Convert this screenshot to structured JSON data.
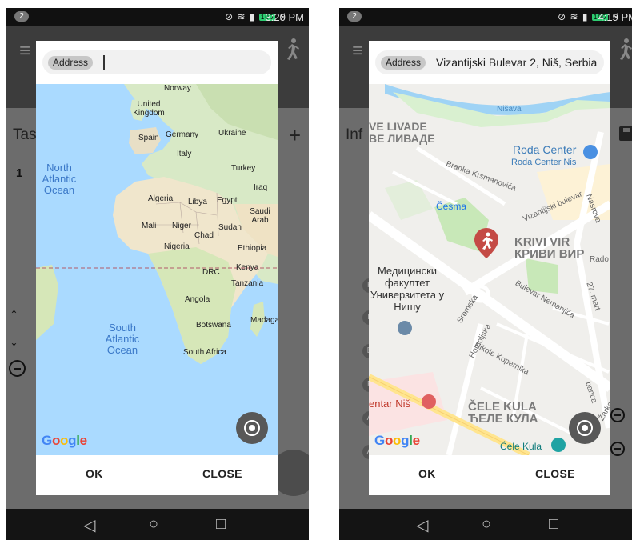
{
  "screens": [
    {
      "status": {
        "notifications": "2",
        "battery": "100",
        "time": "3:20 PM"
      },
      "background": {
        "title": "Tas",
        "action": "+",
        "row_number": "1"
      },
      "address_label": "Address",
      "address_value": "",
      "map_labels": {
        "norway": "Norway",
        "uk": "United Kingdom",
        "germany": "Germany",
        "ukraine": "Ukraine",
        "spain": "Spain",
        "italy": "Italy",
        "turkey": "Turkey",
        "iraq": "Iraq",
        "north_atlantic": "North Atlantic Ocean",
        "algeria": "Algeria",
        "libya": "Libya",
        "egypt": "Egypt",
        "saudi": "Saudi Arab",
        "mali": "Mali",
        "niger": "Niger",
        "chad": "Chad",
        "sudan": "Sudan",
        "nigeria": "Nigeria",
        "ethiopia": "Ethiopia",
        "drc": "DRC",
        "kenya": "Kenya",
        "tanzania": "Tanzania",
        "angola": "Angola",
        "south_atlantic": "South Atlantic Ocean",
        "botswana": "Botswana",
        "madagascar": "Madaga",
        "south_africa": "South Africa"
      },
      "logo": "Google",
      "ok": "OK",
      "close": "CLOSE"
    },
    {
      "status": {
        "notifications": "2",
        "battery": "100",
        "time": "4:19 PM"
      },
      "background": {
        "title": "Inf"
      },
      "address_label": "Address",
      "address_value": "Vizantijski Bulevar 2, Niš, Serbia",
      "map_labels": {
        "nisava": "Nišava",
        "livade_lat": "VE LIVADE",
        "livade_cyr": "ВЕ ЛИВАДЕ",
        "roda_center": "Roda Center",
        "roda_center_nis": "Roda Center Nis",
        "branka": "Branka Krsmanovića",
        "cesma": "Česma",
        "vizantijski": "Vizantijski bulevar",
        "nasrova": "Nasrova",
        "krivi_vir_lat": "KRIVI VIR",
        "krivi_vir_cyr": "КРИВИ ВИР",
        "rado": "Rado",
        "faculty": "Медицински факултет Универзитета у Нишу",
        "bulevar_nemanjica": "Bulevar Nemanjića",
        "sremska": "Sremska",
        "homoljska": "Homoljska",
        "nikole": "Nikole Kopernika",
        "mart": "27. mart",
        "centar_nis": "entar Niš",
        "cele_kula_lat": "ČELE KULA",
        "cele_kula_cyr": "ЋЕЛЕ КУЛА",
        "cele_kula_poi": "Ćele Kula",
        "banca": "banca",
        "zarka": "Žarka Đurića"
      },
      "logo": "Google",
      "ok": "OK",
      "close": "CLOSE"
    }
  ]
}
